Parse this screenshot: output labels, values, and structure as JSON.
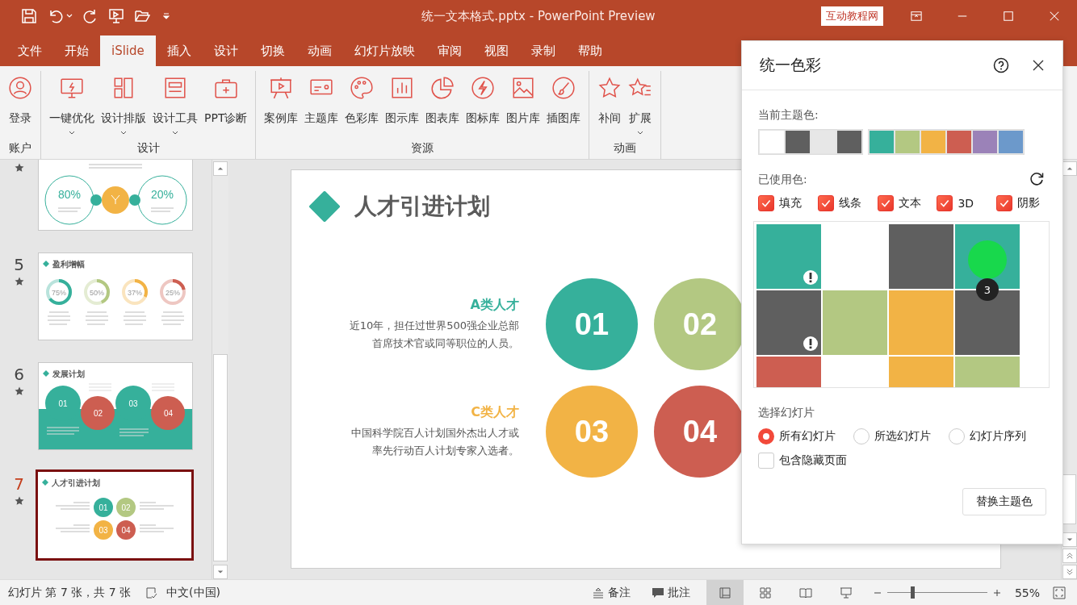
{
  "title_bar": {
    "title": "统一文本格式.pptx - PowerPoint Preview",
    "badge": "互动教程网"
  },
  "tabs": [
    {
      "label": "文件",
      "selected": false
    },
    {
      "label": "开始",
      "selected": false
    },
    {
      "label": "iSlide",
      "selected": true
    },
    {
      "label": "插入",
      "selected": false
    },
    {
      "label": "设计",
      "selected": false
    },
    {
      "label": "切换",
      "selected": false
    },
    {
      "label": "动画",
      "selected": false
    },
    {
      "label": "幻灯片放映",
      "selected": false
    },
    {
      "label": "审阅",
      "selected": false
    },
    {
      "label": "视图",
      "selected": false
    },
    {
      "label": "录制",
      "selected": false
    },
    {
      "label": "帮助",
      "selected": false
    }
  ],
  "ribbon": {
    "groups": [
      {
        "label": "账户",
        "buttons": [
          {
            "label": "登录",
            "dropdown": false
          }
        ]
      },
      {
        "label": "设计",
        "buttons": [
          {
            "label": "一键优化",
            "dropdown": true
          },
          {
            "label": "设计排版",
            "dropdown": true
          },
          {
            "label": "设计工具",
            "dropdown": true
          },
          {
            "label": "PPT诊断",
            "dropdown": false
          }
        ]
      },
      {
        "label": "资源",
        "buttons": [
          {
            "label": "案例库",
            "dropdown": false
          },
          {
            "label": "主题库",
            "dropdown": false
          },
          {
            "label": "色彩库",
            "dropdown": false
          },
          {
            "label": "图示库",
            "dropdown": false
          },
          {
            "label": "图表库",
            "dropdown": false
          },
          {
            "label": "图标库",
            "dropdown": false
          },
          {
            "label": "图片库",
            "dropdown": false
          },
          {
            "label": "插图库",
            "dropdown": false
          }
        ]
      },
      {
        "label": "动画",
        "buttons": [
          {
            "label": "补间",
            "dropdown": false
          },
          {
            "label": "扩展",
            "dropdown": true
          }
        ]
      }
    ]
  },
  "slides": [
    {
      "kind": "percent-circles",
      "starred": true,
      "selected": false,
      "labels": [
        "80%",
        "20%"
      ]
    },
    {
      "number": "5",
      "kind": "donuts",
      "title": "盈利增幅",
      "starred": true,
      "selected": false,
      "labels": [
        "75%",
        "50%",
        "37%",
        "25%"
      ]
    },
    {
      "number": "6",
      "kind": "steps",
      "title": "发展计划",
      "starred": true,
      "selected": false,
      "labels": [
        "01",
        "02",
        "03",
        "04"
      ]
    },
    {
      "number": "7",
      "kind": "circles",
      "title": "人才引进计划",
      "starred": true,
      "selected": true,
      "labels": [
        "01",
        "02",
        "03",
        "04"
      ]
    }
  ],
  "slide": {
    "title": "人才引进计划",
    "rows": [
      {
        "heading": "A类人才",
        "color": "#36b09b",
        "lines": [
          "近10年，担任过世界500强企业总部",
          "首席技术官或同等职位的人员。"
        ],
        "circles": [
          {
            "label": "01",
            "color": "#36b09b"
          },
          {
            "label": "02",
            "color": "#b3c882"
          }
        ]
      },
      {
        "heading": "C类人才",
        "color": "#f2b345",
        "lines": [
          "中国科学院百人计划国外杰出人才或",
          "率先行动百人计划专家入选者。"
        ],
        "circles": [
          {
            "label": "03",
            "color": "#f2b345"
          },
          {
            "label": "04",
            "color": "#cd5e51"
          }
        ]
      }
    ]
  },
  "panel": {
    "title": "统一色彩",
    "theme_label": "当前主题色:",
    "theme_groups": [
      [
        {
          "color": "#ffffff"
        },
        {
          "color": "#5f5f5f"
        },
        {
          "color": "#e7e7e7"
        },
        {
          "color": "#5f5f5f"
        }
      ],
      [
        {
          "color": "#36b09b"
        },
        {
          "color": "#b3c882"
        },
        {
          "color": "#f2b345"
        },
        {
          "color": "#cd5e51"
        },
        {
          "color": "#9b82b8"
        },
        {
          "color": "#6c99cb"
        }
      ]
    ],
    "used_label": "已使用色:",
    "filters": [
      {
        "label": "填充",
        "checked": true
      },
      {
        "label": "线条",
        "checked": true
      },
      {
        "label": "文本",
        "checked": true
      },
      {
        "label": "3D",
        "checked": true
      },
      {
        "label": "阴影",
        "checked": true
      }
    ],
    "cells": [
      {
        "kind": "swatch",
        "color": "#36b09b",
        "warning": true
      },
      {
        "kind": "empty"
      },
      {
        "kind": "swatch",
        "color": "#5f5f5f",
        "warning": false
      },
      {
        "kind": "swatch",
        "color": "#36b09b",
        "warning": false,
        "count": "3"
      },
      {
        "kind": "swatch",
        "color": "#5f5f5f",
        "warning": true
      },
      {
        "kind": "swatch",
        "color": "#b3c882",
        "warning": false
      },
      {
        "kind": "swatch",
        "color": "#f2b345",
        "warning": false
      },
      {
        "kind": "swatch",
        "color": "#5f5f5f",
        "warning": false
      },
      {
        "kind": "swatch",
        "color": "#cd5e51"
      },
      {
        "kind": "empty"
      },
      {
        "kind": "swatch",
        "color": "#f2b345"
      },
      {
        "kind": "swatch",
        "color": "#b3c882"
      }
    ],
    "scope_label": "选择幻灯片",
    "scopes": [
      {
        "label": "所有幻灯片",
        "selected": true
      },
      {
        "label": "所选幻灯片",
        "selected": false
      },
      {
        "label": "幻灯片序列",
        "selected": false
      }
    ],
    "include_hidden": {
      "label": "包含隐藏页面",
      "checked": false
    },
    "apply_button": "替换主题色"
  },
  "status_bar": {
    "slide_info": "幻灯片 第 7 张，共 7 张",
    "language": "中文(中国)",
    "notes": "备注",
    "comments": "批注",
    "views": [
      {
        "selected": true
      },
      {
        "selected": false
      },
      {
        "selected": false
      },
      {
        "selected": false
      }
    ],
    "zoom": {
      "level": 0.25,
      "reading": "55%"
    }
  }
}
